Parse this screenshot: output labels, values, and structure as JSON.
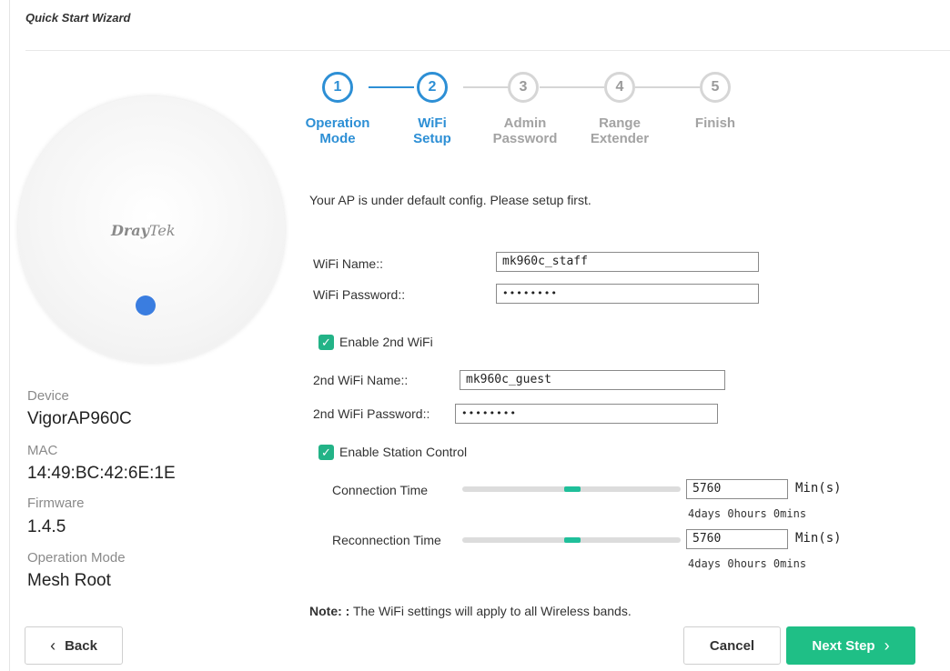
{
  "page": {
    "title": "Quick Start Wizard"
  },
  "colors": {
    "accent": "#2d8fd5",
    "brand_green": "#1fbf86",
    "led": "#3a7de0",
    "inactive": "#d6d6d6"
  },
  "stepper": {
    "steps": [
      {
        "number": "1",
        "label_line1": "Operation",
        "label_line2": "Mode",
        "state": "complete"
      },
      {
        "number": "2",
        "label_line1": "WiFi",
        "label_line2": "Setup",
        "state": "active"
      },
      {
        "number": "3",
        "label_line1": "Admin",
        "label_line2": "Password",
        "state": "pending"
      },
      {
        "number": "4",
        "label_line1": "Range",
        "label_line2": "Extender",
        "state": "pending"
      },
      {
        "number": "5",
        "label_line1": "Finish",
        "label_line2": "",
        "state": "pending"
      }
    ]
  },
  "device": {
    "logo_text_bold": "Dray",
    "logo_text_light": "Tek",
    "device_label": "Device",
    "device_value": "VigorAP960C",
    "mac_label": "MAC",
    "mac_value": "14:49:BC:42:6E:1E",
    "firmware_label": "Firmware",
    "firmware_value": "1.4.5",
    "mode_label": "Operation Mode",
    "mode_value": "Mesh Root"
  },
  "form": {
    "intro": "Your AP is under default config. Please setup first.",
    "wifi_name_label": "WiFi Name::",
    "wifi_name_value": "mk960c_staff",
    "wifi_password_label": "WiFi Password::",
    "wifi_password_value": "••••••••",
    "enable_2nd_label": "Enable 2nd WiFi",
    "enable_2nd_checked": true,
    "wifi2_name_label": "2nd WiFi Name::",
    "wifi2_name_value": "mk960c_guest",
    "wifi2_password_label": "2nd WiFi Password::",
    "wifi2_password_value": "••••••••",
    "station_control_label": "Enable Station Control",
    "station_control_checked": true,
    "connection_time_label": "Connection Time",
    "connection_time_value": "5760",
    "connection_time_unit": "Min(s)",
    "connection_time_hint": "4days 0hours 0mins",
    "connection_time_level": 0.5,
    "reconnection_time_label": "Reconnection Time",
    "reconnection_time_value": "5760",
    "reconnection_time_unit": "Min(s)",
    "reconnection_time_hint": "4days 0hours 0mins",
    "reconnection_time_level": 0.5,
    "note_bold": "Note: :",
    "note_text": " The WiFi settings will apply to all Wireless bands."
  },
  "buttons": {
    "back": "Back",
    "cancel": "Cancel",
    "next": "Next Step"
  },
  "icons": {
    "back": "chevron-left-icon",
    "next": "chevron-right-icon",
    "check": "check-icon"
  }
}
